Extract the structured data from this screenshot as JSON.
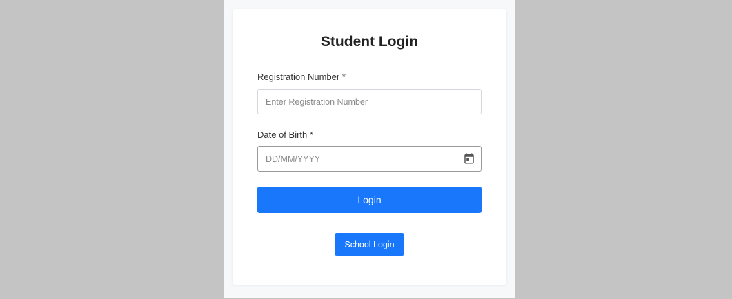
{
  "page": {
    "title": "Student Login"
  },
  "form": {
    "registration": {
      "label": "Registration Number *",
      "placeholder": "Enter Registration Number",
      "value": ""
    },
    "dob": {
      "label": "Date of Birth *",
      "placeholder": "DD/MM/YYYY",
      "value": "",
      "icon": "calendar-icon"
    },
    "login_label": "Login",
    "school_login_label": "School Login"
  },
  "colors": {
    "primary": "#1877fa",
    "background": "#c4c4c4",
    "panel": "#f7f8fa",
    "card": "#ffffff"
  }
}
